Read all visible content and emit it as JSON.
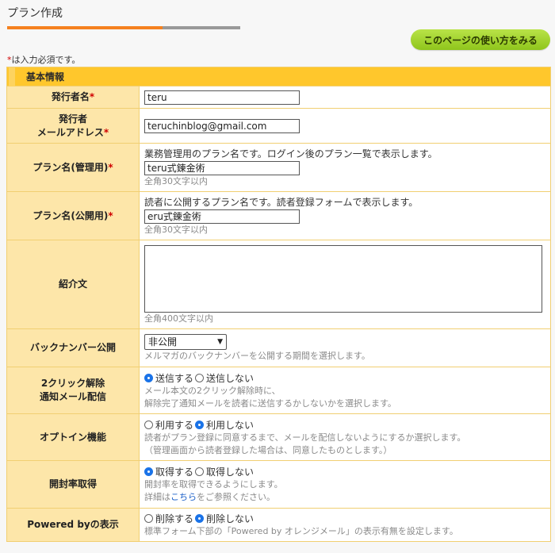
{
  "header": {
    "title": "プラン作成",
    "help_button": "このページの使い方をみる",
    "required_note_mark": "*",
    "required_note": "は入力必須です。"
  },
  "section": {
    "title": "基本情報"
  },
  "rows": {
    "issuer": {
      "label": "発行者名",
      "required": "*",
      "value": "teru"
    },
    "email": {
      "label_line1": "発行者",
      "label_line2": "メールアドレス",
      "required": "*",
      "value": "teruchinblog@gmail.com"
    },
    "plan_admin": {
      "label": "プラン名(管理用)",
      "required": "*",
      "desc": "業務管理用のプラン名です。ログイン後のプラン一覧で表示します。",
      "value": "teru式錬金術",
      "hint": "全角30文字以内"
    },
    "plan_public": {
      "label": "プラン名(公開用)",
      "required": "*",
      "desc": "読者に公開するプラン名です。読者登録フォームで表示します。",
      "value": "eru式錬金術",
      "hint": "全角30文字以内"
    },
    "intro": {
      "label": "紹介文",
      "hint": "全角400文字以内"
    },
    "backnumber": {
      "label": "バックナンバー公開",
      "selected": "非公開",
      "hint": "メルマガのバックナンバーを公開する期間を選択します。"
    },
    "two_click": {
      "label_line1": "2クリック解除",
      "label_line2": "通知メール配信",
      "option_on": "送信する",
      "option_off": "送信しない",
      "selected": "on",
      "hint1": "メール本文の2クリック解除時に、",
      "hint2": "解除完了通知メールを読者に送信するかしないかを選択します。"
    },
    "optin": {
      "label": "オプトイン機能",
      "option_on": "利用する",
      "option_off": "利用しない",
      "selected": "off",
      "hint1": "読者がプラン登録に同意するまで、メールを配信しないようにするか選択します。",
      "hint2": "（管理画面から読者登録した場合は、同意したものとします。）"
    },
    "open_rate": {
      "label": "開封率取得",
      "option_on": "取得する",
      "option_off": "取得しない",
      "selected": "on",
      "hint1": "開封率を取得できるようにします。",
      "hint2_before": "詳細は",
      "hint2_link": "こちら",
      "hint2_after": "をご参照ください。"
    },
    "powered_by": {
      "label": "Powered byの表示",
      "option_on": "削除する",
      "option_off": "削除しない",
      "selected": "off",
      "hint": "標準フォーム下部の「Powered by オレンジメール」の表示有無を設定します。"
    }
  },
  "colors": {
    "accent_orange": "#f5811f",
    "section_yellow": "#ffc72c",
    "label_bg": "#fde6a9",
    "help_button_green": "#9acd32",
    "radio_blue": "#1a73e8"
  }
}
